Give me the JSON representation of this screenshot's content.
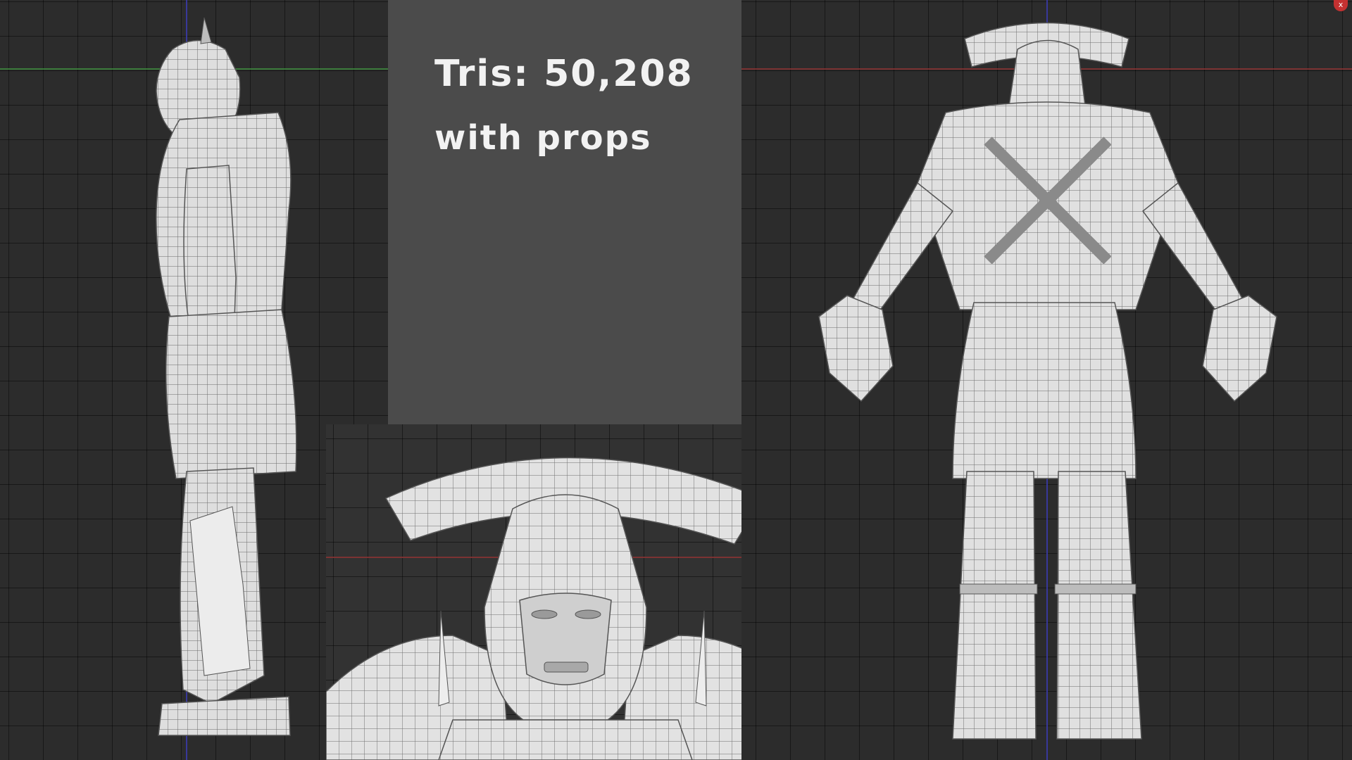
{
  "info": {
    "tris_label": "Tris: 50,208",
    "props_label": "with props"
  },
  "close_button": {
    "label": "x",
    "color": "#c43131"
  },
  "views": [
    {
      "name": "side-view"
    },
    {
      "name": "back-view"
    },
    {
      "name": "face-closeup"
    }
  ],
  "colors": {
    "viewport_bg": "#2c2c2c",
    "panel_bg": "#4b4b4b",
    "mesh_fill": "#e4e4e4",
    "wire": "#707070",
    "axis_x": "#8a3434",
    "axis_y": "#3e8a3e",
    "axis_z": "#3a3aa6"
  }
}
